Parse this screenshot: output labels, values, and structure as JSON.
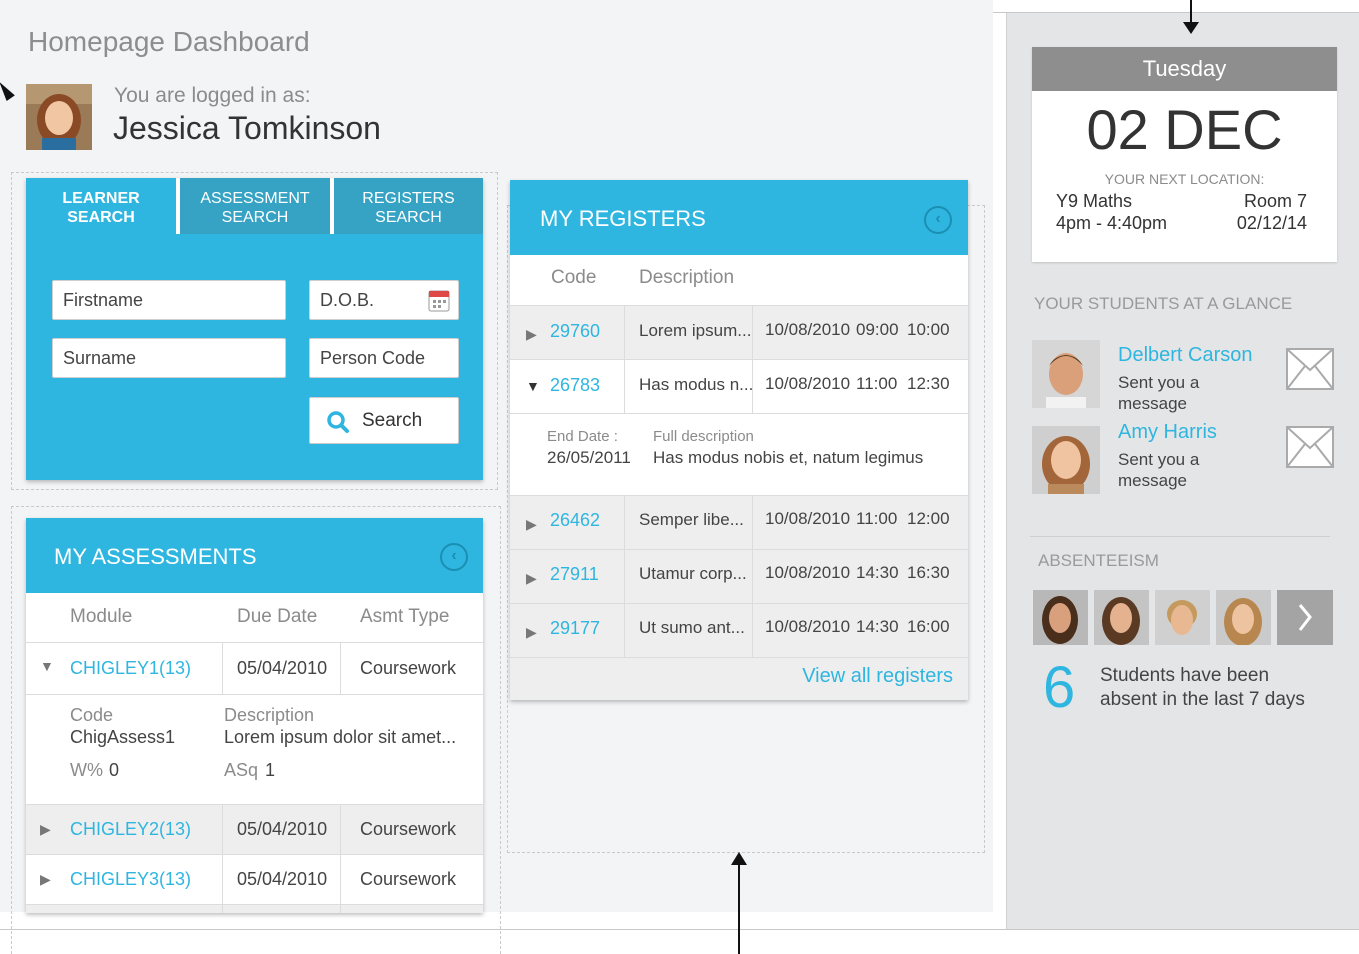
{
  "header": {
    "page_title": "Homepage Dashboard",
    "logged_in_label": "You are logged in as:",
    "user_name": "Jessica Tomkinson"
  },
  "learner_search": {
    "tabs": [
      {
        "line1": "LEARNER",
        "line2": "SEARCH"
      },
      {
        "line1": "ASSESSMENT",
        "line2": "SEARCH"
      },
      {
        "line1": "REGISTERS",
        "line2": "SEARCH"
      }
    ],
    "firstname_placeholder": "Firstname",
    "dob_placeholder": "D.O.B.",
    "surname_placeholder": "Surname",
    "person_code_placeholder": "Person Code",
    "search_label": "Search"
  },
  "assessments": {
    "title": "MY ASSESSMENTS",
    "columns": [
      "Module",
      "Due Date",
      "Asmt Type"
    ],
    "rows": [
      {
        "module": "CHIGLEY1(13)",
        "due": "05/04/2010",
        "type": "Coursework"
      },
      {
        "module": "CHIGLEY2(13)",
        "due": "05/04/2010",
        "type": "Coursework"
      },
      {
        "module": "CHIGLEY3(13)",
        "due": "05/04/2010",
        "type": "Coursework"
      }
    ],
    "detail": {
      "code_label": "Code",
      "code_value": "ChigAssess1",
      "desc_label": "Description",
      "desc_value": "Lorem ipsum dolor sit amet...",
      "w_label": "W%",
      "w_value": "0",
      "asq_label": "ASq",
      "asq_value": "1"
    }
  },
  "registers": {
    "title": "MY REGISTERS",
    "columns": [
      "Code",
      "Description"
    ],
    "rows": [
      {
        "code": "29760",
        "desc": "Lorem ipsum...",
        "date": "10/08/2010",
        "start": "09:00",
        "end": "10:00"
      },
      {
        "code": "26783",
        "desc": "Has modus n...",
        "date": "10/08/2010",
        "start": "11:00",
        "end": "12:30"
      },
      {
        "code": "26462",
        "desc": "Semper libe...",
        "date": "10/08/2010",
        "start": "11:00",
        "end": "12:00"
      },
      {
        "code": "27911",
        "desc": "Utamur corp...",
        "date": "10/08/2010",
        "start": "14:30",
        "end": "16:30"
      },
      {
        "code": "29177",
        "desc": "Ut sumo ant...",
        "date": "10/08/2010",
        "start": "14:30",
        "end": "16:00"
      }
    ],
    "detail": {
      "end_date_label": "End Date :",
      "end_date_value": "26/05/2011",
      "full_desc_label": "Full description",
      "full_desc_value": "Has modus nobis et, natum legimus"
    },
    "view_all": "View all registers"
  },
  "calendar": {
    "day": "Tuesday",
    "date": "02 DEC",
    "next_location_label": "YOUR NEXT LOCATION:",
    "subject": "Y9 Maths",
    "room": "Room 7",
    "time": "4pm - 4:40pm",
    "short_date": "02/12/14"
  },
  "students": {
    "title": "YOUR STUDENTS AT A GLANCE",
    "items": [
      {
        "name": "Delbert Carson",
        "line1": "Sent you a",
        "line2": "message"
      },
      {
        "name": "Amy Harris",
        "line1": "Sent you a",
        "line2": "message"
      }
    ]
  },
  "absenteeism": {
    "title": "ABSENTEEISM",
    "count": "6",
    "line1": "Students have been",
    "line2": "absent in the last 7 days"
  },
  "colors": {
    "accent": "#2eb6e0",
    "tab_inactive": "#36a3c4",
    "calendar_header": "#8e8e8e",
    "sidebar_bg": "#e4e5e6"
  }
}
